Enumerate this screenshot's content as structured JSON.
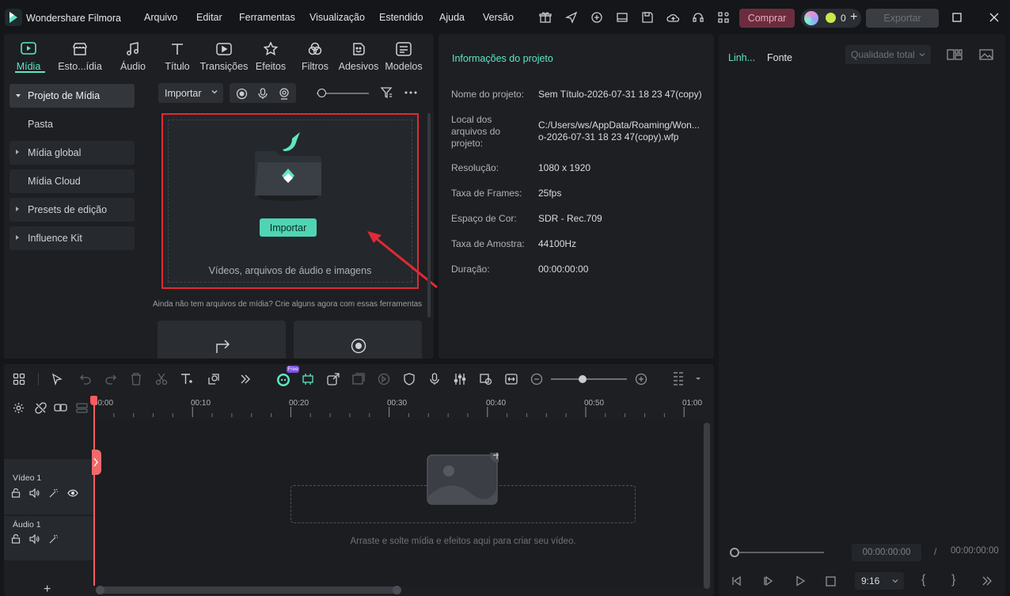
{
  "titlebar": {
    "app_title": "Wondershare Filmora",
    "menus": [
      "Arquivo",
      "Editar",
      "Ferramentas",
      "Visualização",
      "Estendido",
      "Ajuda",
      "Versão"
    ],
    "buy_label": "Comprar",
    "credits_count": "0",
    "export_label": "Exportar"
  },
  "media_tabs": [
    {
      "label": "Mídia",
      "icon": "media-icon",
      "active": true
    },
    {
      "label": "Esto...ídia",
      "icon": "stock-store-icon"
    },
    {
      "label": "Áudio",
      "icon": "music-note-icon"
    },
    {
      "label": "Título",
      "icon": "title-t-icon"
    },
    {
      "label": "Transições",
      "icon": "transitions-icon"
    },
    {
      "label": "Efeitos",
      "icon": "effects-star-icon"
    },
    {
      "label": "Filtros",
      "icon": "filters-icon"
    },
    {
      "label": "Adesivos",
      "icon": "stickers-icon"
    },
    {
      "label": "Modelos",
      "icon": "templates-icon"
    }
  ],
  "sidebar": {
    "items": [
      {
        "label": "Projeto de Mídia",
        "expanded": true,
        "active": true
      },
      {
        "label": "Pasta"
      },
      {
        "label": "Mídia global",
        "expandable": true
      },
      {
        "label": "Mídia Cloud"
      },
      {
        "label": "Presets de edição",
        "expandable": true
      },
      {
        "label": "Influence Kit",
        "expandable": true
      }
    ]
  },
  "media": {
    "import_dropdown": "Importar",
    "import_button": "Importar",
    "dropzone_caption": "Vídeos, arquivos de áudio e imagens",
    "hint": "Ainda não tem arquivos de mídia? Crie alguns agora com essas ferramentas"
  },
  "project_info": {
    "title": "Informações do projeto",
    "rows": [
      {
        "label": "Nome do projeto:",
        "value": "Sem Título-2026-07-31 18 23 47(copy)"
      },
      {
        "label": "Local dos arquivos do projeto:",
        "value": "C:/Users/ws/AppData/Roaming/Won...\no-2026-07-31 18 23 47(copy).wfp"
      },
      {
        "label": "Resolução:",
        "value": "1080 x 1920"
      },
      {
        "label": "Taxa de Frames:",
        "value": "25fps"
      },
      {
        "label": "Espaço de Cor:",
        "value": "SDR - Rec.709"
      },
      {
        "label": "Taxa de Amostra:",
        "value": "44100Hz"
      },
      {
        "label": "Duração:",
        "value": "00:00:00:00"
      }
    ]
  },
  "preview": {
    "tab_timeline": "Linh...",
    "tab_source": "Fonte",
    "quality": "Qualidade total",
    "current_time": "00:00:00:00",
    "separator": "/",
    "total_time": "00:00:00:00",
    "aspect_ratio": "9:16"
  },
  "timeline": {
    "ruler_ticks": [
      "00:00",
      "00:10",
      "00:20",
      "00:30",
      "00:40",
      "00:50",
      "01:00"
    ],
    "free_badge": "Free",
    "tracks": [
      {
        "name": "Vídeo 1"
      },
      {
        "name": "Áudio 1"
      }
    ],
    "drop_hint": "Arraste e solte mídia e efeitos aqui para criar seu vídeo."
  },
  "colors": {
    "accent": "#5ee6c5",
    "highlight_box": "#e02a35",
    "buy_bg": "#6b2d3e",
    "playhead": "#ff5a5f"
  }
}
